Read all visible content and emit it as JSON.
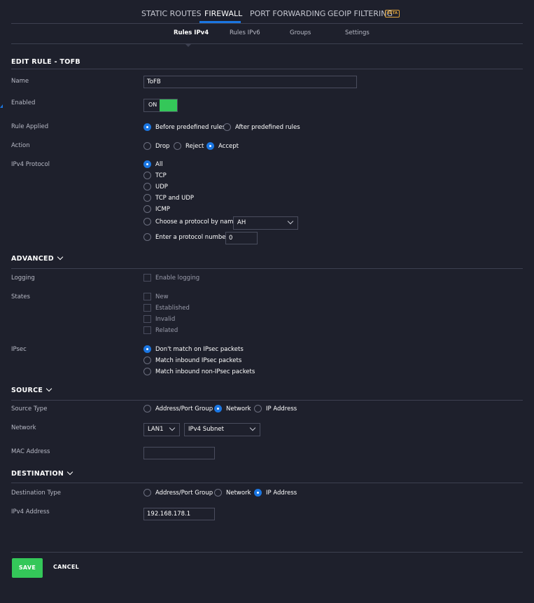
{
  "top_tabs": {
    "static_routes": "STATIC ROUTES",
    "firewall": "FIREWALL",
    "port_forwarding": "PORT FORWARDING",
    "geoip_filtering": "GEOIP FILTERING",
    "beta_badge": "BETA"
  },
  "sub_tabs": {
    "rules_ipv4": "Rules IPv4",
    "rules_ipv6": "Rules IPv6",
    "groups": "Groups",
    "settings": "Settings"
  },
  "edit_rule": {
    "title": "EDIT RULE - TOFB",
    "name_label": "Name",
    "name_value": "ToFB",
    "enabled_label": "Enabled",
    "enabled_state": "ON",
    "rule_applied_label": "Rule Applied",
    "rule_applied_options": [
      "Before predefined rules",
      "After predefined rules"
    ],
    "action_label": "Action",
    "action_options": [
      "Drop",
      "Reject",
      "Accept"
    ],
    "protocol_label": "IPv4 Protocol",
    "protocol_options": [
      "All",
      "TCP",
      "UDP",
      "TCP and UDP",
      "ICMP",
      "Choose a protocol by name",
      "Enter a protocol number"
    ],
    "protocol_name_value": "AH",
    "protocol_number_value": "0"
  },
  "advanced": {
    "title": "ADVANCED",
    "logging_label": "Logging",
    "logging_option": "Enable logging",
    "states_label": "States",
    "states": [
      "New",
      "Established",
      "Invalid",
      "Related"
    ],
    "ipsec_label": "IPsec",
    "ipsec_options": [
      "Don't match on IPsec packets",
      "Match inbound IPsec packets",
      "Match inbound non-IPsec packets"
    ]
  },
  "source": {
    "title": "SOURCE",
    "type_label": "Source Type",
    "type_options": [
      "Address/Port Group",
      "Network",
      "IP Address"
    ],
    "network_label": "Network",
    "network_value": "LAN1",
    "subnet_value": "IPv4 Subnet",
    "mac_label": "MAC Address",
    "mac_value": ""
  },
  "destination": {
    "title": "DESTINATION",
    "type_label": "Destination Type",
    "type_options": [
      "Address/Port Group",
      "Network",
      "IP Address"
    ],
    "ip_label": "IPv4 Address",
    "ip_value": "192.168.178.1"
  },
  "footer": {
    "save": "SAVE",
    "cancel": "CANCEL"
  },
  "colors": {
    "background": "#1e202c",
    "accent_blue": "#1b76e2",
    "success_green": "#34c759",
    "beta_orange": "#e1a53b"
  }
}
